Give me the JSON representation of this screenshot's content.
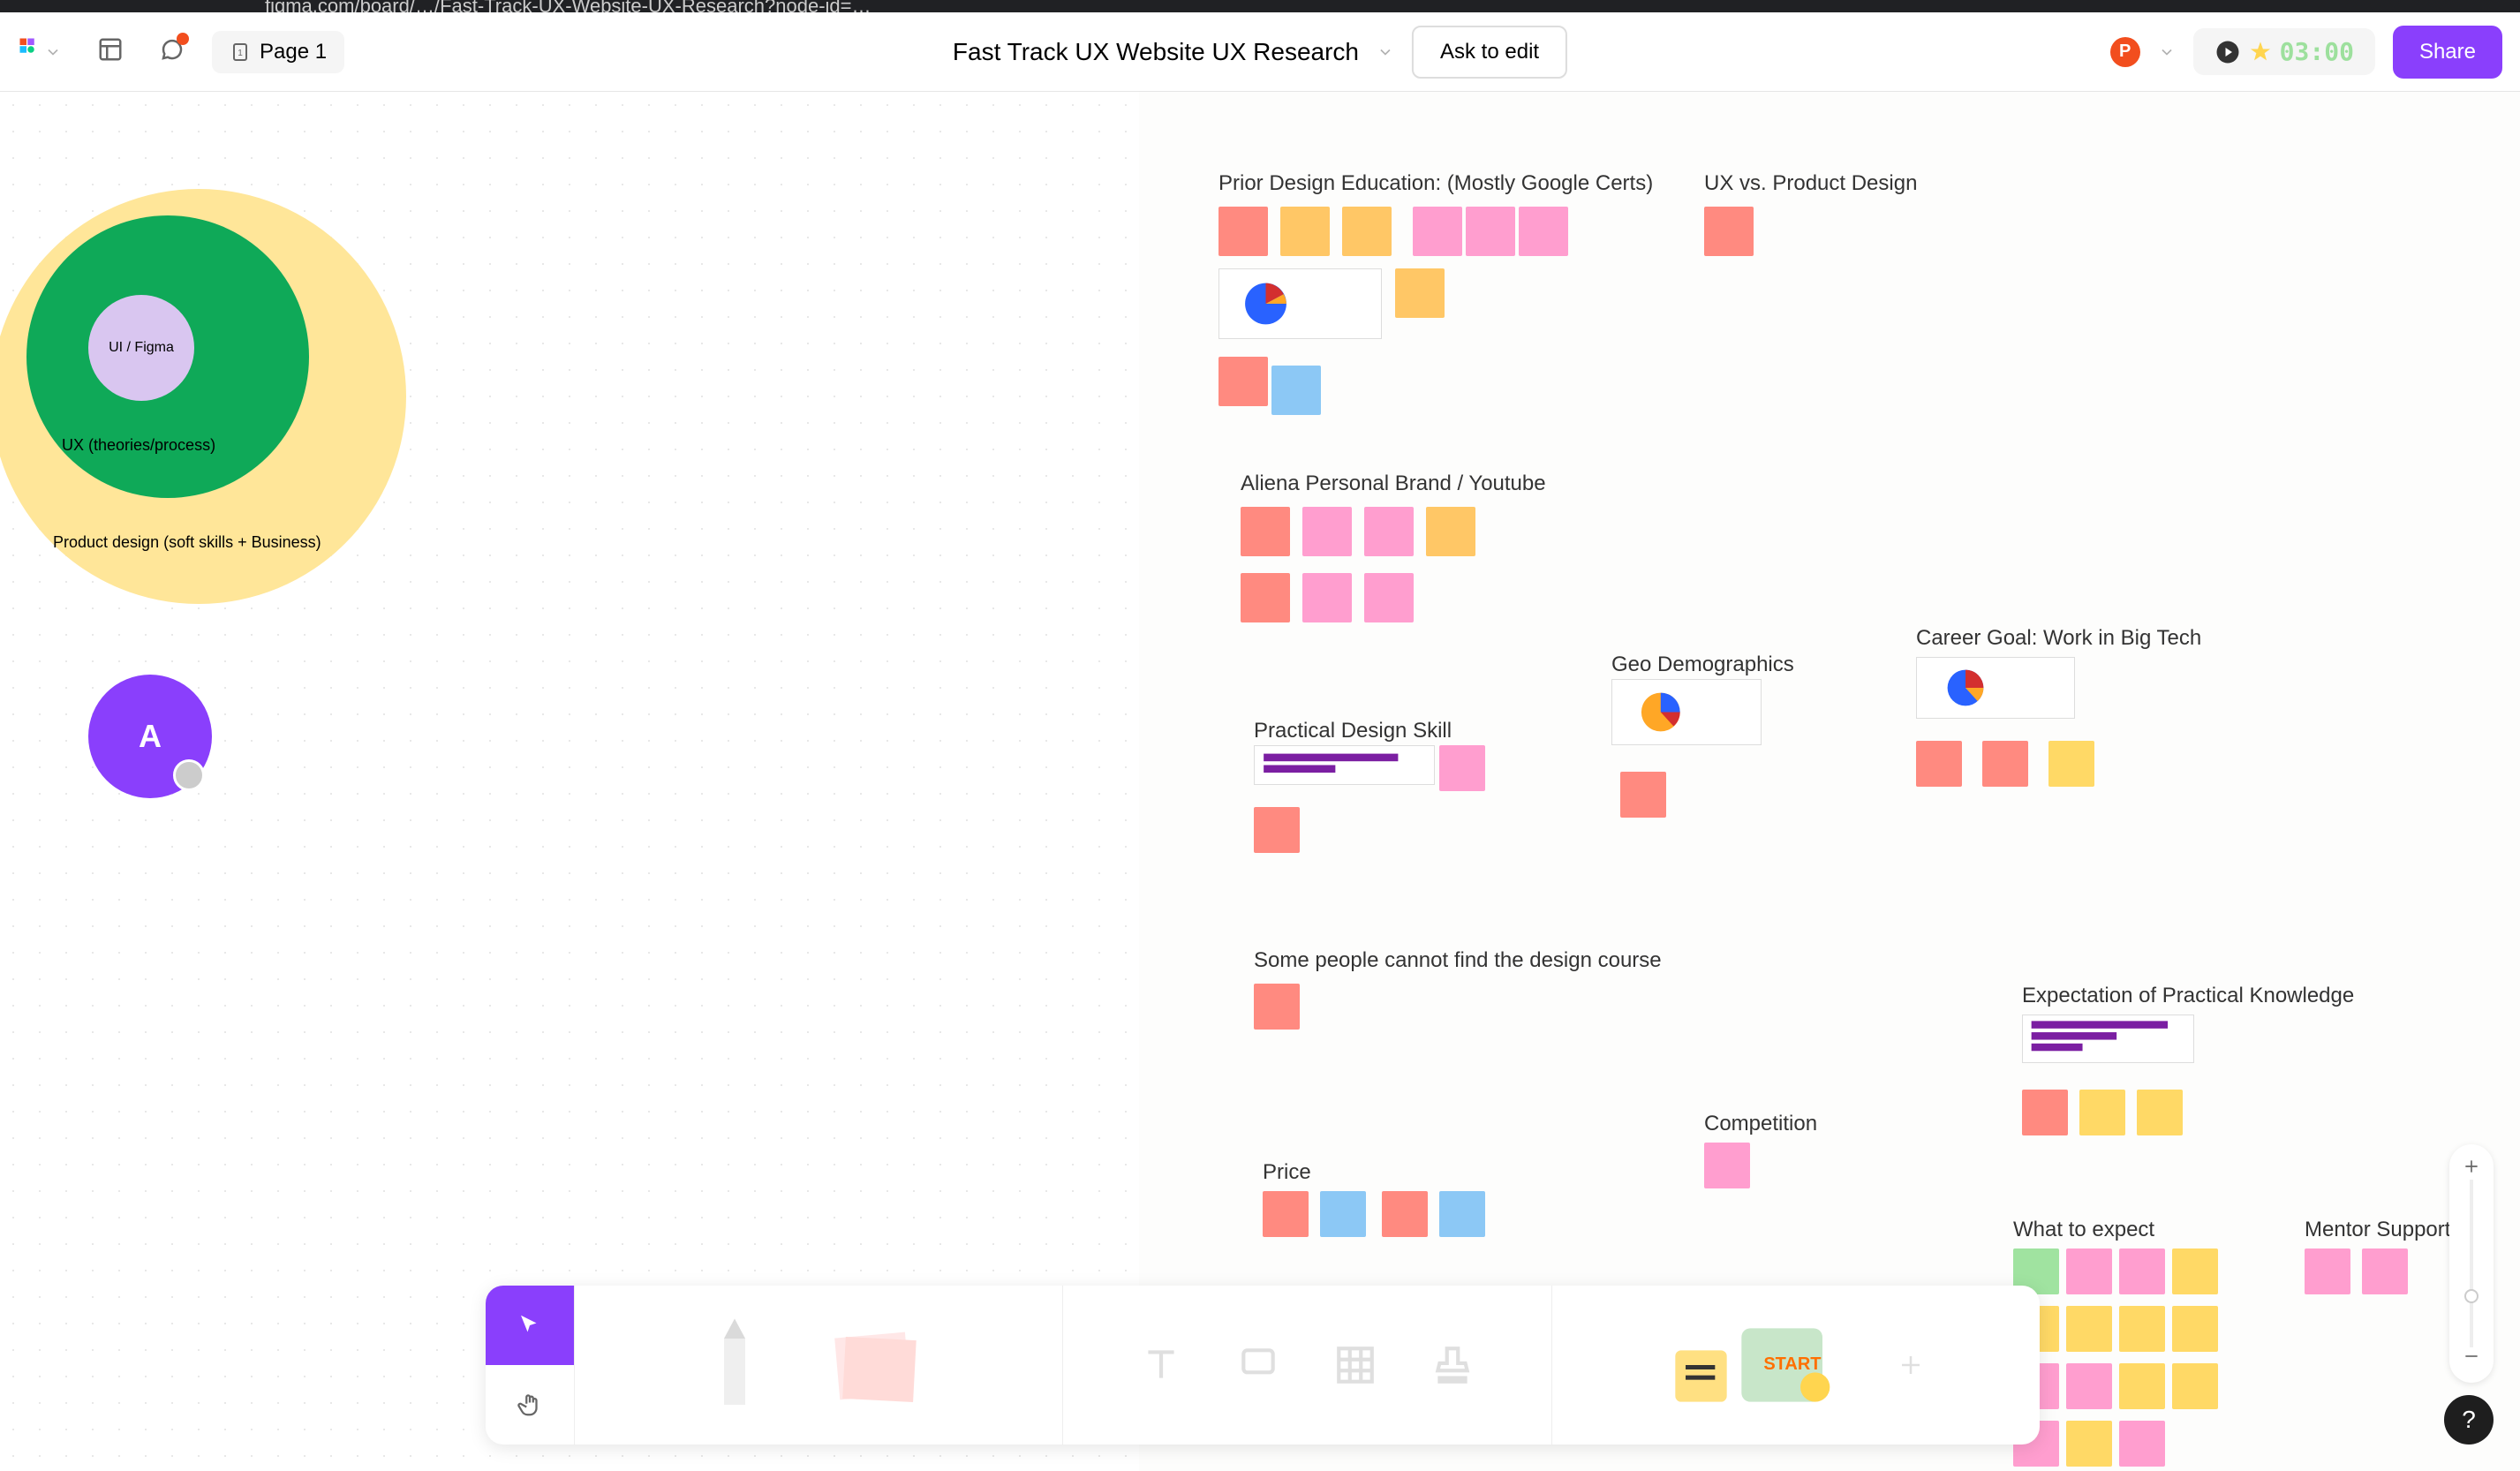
{
  "browser": {
    "url_fragment": "figma.com/board/…/Fast-Track-UX-Website-UX-Research?node-id=…"
  },
  "toolbar": {
    "page_label": "Page 1",
    "doc_title": "Fast Track UX Website UX Research",
    "ask_label": "Ask to edit",
    "share_label": "Share",
    "avatar_initial": "P",
    "timer": "03:00"
  },
  "circles": {
    "inner": "UI / Figma",
    "mid": "UX (theories/process)",
    "outer": "Product design (soft skills + Business)"
  },
  "cursor": {
    "initial": "A"
  },
  "groups": {
    "prior_edu": "Prior Design Education: (Mostly Google Certs)",
    "ux_vs_pd": "UX vs. Product Design",
    "brand": "Aliena Personal Brand / Youtube",
    "practical": "Practical Design Skill",
    "geo": "Geo Demographics",
    "career": "Career Goal: Work in Big Tech",
    "cannot_find": "Some people cannot find the design course",
    "expectation": "Expectation of Practical Knowledge",
    "price": "Price",
    "competition": "Competition",
    "expect": "What to expect",
    "mentor": "Mentor Support"
  },
  "colors": {
    "purple": "#8a3ffc",
    "green": "#0fa958",
    "yellow": "#ffe699",
    "lavender": "#d9c6f0",
    "figma_orange": "#f24e1e"
  },
  "help_label": "?"
}
